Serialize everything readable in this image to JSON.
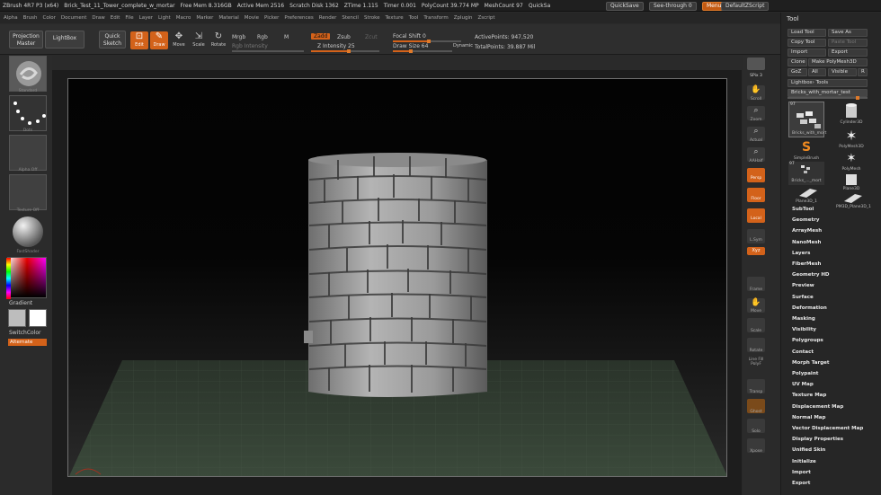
{
  "titlebar": {
    "items": [
      "ZBrush 4R7 P3 (x64)",
      "Brick_Test_11_Tower_complete_w_mortar",
      "Free Mem 8.316GB",
      "Active Mem 2516",
      "Scratch Disk 1362",
      "ZTime 1.115",
      "Timer 0.001",
      "PolyCount 39.774 MP",
      "MeshCount 97",
      "QuickSa"
    ],
    "quicksave": "QuickSave",
    "seethrough": "See-through   0",
    "menus": "Menus",
    "defaultzscript": "DefaultZScript"
  },
  "menubar": [
    "Alpha",
    "Brush",
    "Color",
    "Document",
    "Draw",
    "Edit",
    "File",
    "Layer",
    "Light",
    "Macro",
    "Marker",
    "Material",
    "Movie",
    "Picker",
    "Preferences",
    "Render",
    "Stencil",
    "Stroke",
    "Texture",
    "Tool",
    "Transform",
    "Zplugin",
    "Zscript"
  ],
  "shelf": {
    "projection_master": "Projection Master",
    "lightbox": "LightBox",
    "quick_sketch": "Quick Sketch",
    "edit": "Edit",
    "draw": "Draw",
    "move": "Move",
    "scale": "Scale",
    "rotate": "Rotate",
    "mrgb": "Mrgb",
    "rgb": "Rgb",
    "m": "M",
    "rgb_intensity": "Rgb Intensity",
    "zadd": "Zadd",
    "zsub": "Zsub",
    "zcut": "Zcut",
    "z_intensity": "Z Intensity 25",
    "focal_shift": "Focal Shift 0",
    "draw_size": "Draw Size 64",
    "dynamic": "Dynamic",
    "active_points": "ActivePoints: 947,520",
    "total_points": "TotalPoints: 39.887 Mil"
  },
  "lefttray": {
    "brush": "Standard",
    "stroke": "Dots",
    "alpha": "Alpha Off",
    "texture": "Texture Off",
    "material": "FastShader",
    "gradient": "Gradient",
    "switchcolor": "SwitchColor",
    "alternate": "Alternate"
  },
  "rshelf": {
    "spix": "SPix 3",
    "scroll": "Scroll",
    "zoom": "Zoom",
    "actual": "Actual",
    "aahalf": "AAHalf",
    "persp": "Persp",
    "floor": "Floor",
    "local": "Local",
    "lsym": "L.Sym",
    "xyz": "Xyz",
    "frame": "Frame",
    "move": "Move",
    "scale": "Scale",
    "rotate": "Rotate",
    "line_fill": "Line Fill PolyF",
    "transp": "Transp",
    "ghost": "Ghost",
    "solo": "Solo",
    "xpose": "Xpose"
  },
  "tool_panel": {
    "title": "Tool",
    "load_tool": "Load Tool",
    "save_as": "Save As",
    "copy_tool": "Copy Tool",
    "paste_tool": "Paste Tool",
    "import": "Import",
    "export": "Export",
    "clone": "Clone",
    "make_polymesh": "Make PolyMesh3D",
    "goz": "GoZ",
    "all": "All",
    "visible": "Visible",
    "r": "R",
    "lightbox_tools": "Lightbox› Tools",
    "current_tool": "Bricks_with_mortar_test",
    "tiles": [
      {
        "caption": "Bricks_with_mort",
        "count": "97"
      },
      {
        "caption": "Cylinder3D"
      },
      {
        "caption": "PolyMesh3D"
      },
      {
        "caption": "SimpleBrush"
      },
      {
        "caption": "PolyMesh"
      },
      {
        "caption": "Bricks_..._mort",
        "count": "97"
      },
      {
        "caption": "Plane3D"
      },
      {
        "caption": "Plane3D_1"
      },
      {
        "caption": "PM3D_Plane3D_1"
      }
    ],
    "subpalettes": [
      "SubTool",
      "Geometry",
      "ArrayMesh",
      "NanoMesh",
      "Layers",
      "FiberMesh",
      "Geometry HD",
      "Preview",
      "Surface",
      "Deformation",
      "Masking",
      "Visibility",
      "Polygroups",
      "Contact",
      "Morph Target",
      "Polypaint",
      "UV Map",
      "Texture Map",
      "Displacement Map",
      "Normal Map",
      "Vector Displacement Map",
      "Display Properties",
      "Unified Skin",
      "Initialize",
      "Import",
      "Export"
    ]
  },
  "colors": {
    "accent": "#d3621a",
    "panel": "#262626",
    "canvas_floor": "#3b4a3b"
  }
}
